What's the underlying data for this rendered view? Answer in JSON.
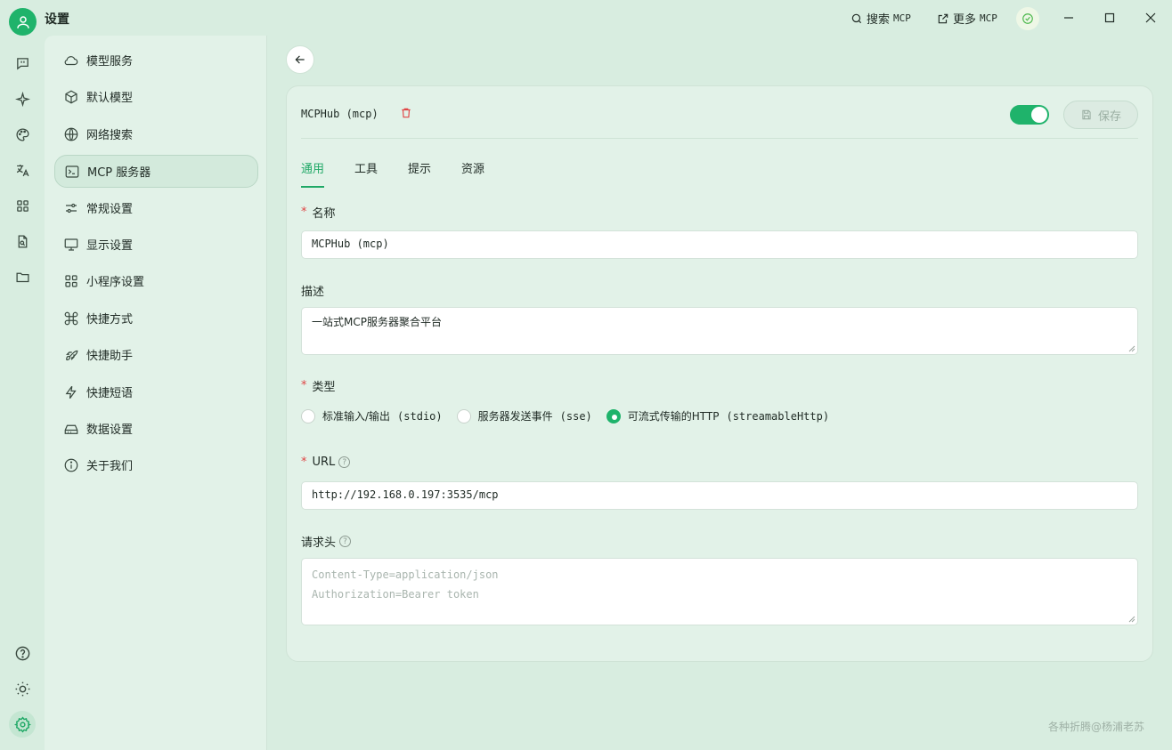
{
  "app": {
    "title": "设置"
  },
  "toolbar": {
    "search_label": "搜索",
    "search_suffix": "MCP",
    "more_label": "更多",
    "more_suffix": "MCP"
  },
  "sidebar": {
    "items": [
      {
        "label": "模型服务",
        "icon": "cloud-icon"
      },
      {
        "label": "默认模型",
        "icon": "cube-icon"
      },
      {
        "label": "网络搜索",
        "icon": "globe-icon"
      },
      {
        "label": "MCP 服务器",
        "icon": "terminal-icon",
        "active": true
      },
      {
        "label": "常规设置",
        "icon": "sliders-icon"
      },
      {
        "label": "显示设置",
        "icon": "monitor-icon"
      },
      {
        "label": "小程序设置",
        "icon": "grid-icon"
      },
      {
        "label": "快捷方式",
        "icon": "command-icon"
      },
      {
        "label": "快捷助手",
        "icon": "rocket-icon"
      },
      {
        "label": "快捷短语",
        "icon": "zap-icon"
      },
      {
        "label": "数据设置",
        "icon": "drive-icon"
      },
      {
        "label": "关于我们",
        "icon": "info-icon"
      }
    ]
  },
  "server": {
    "title": "MCPHub (mcp)",
    "enabled": true,
    "save_label": "保存"
  },
  "tabs": [
    "通用",
    "工具",
    "提示",
    "资源"
  ],
  "form": {
    "name_label": "名称",
    "name_value": "MCPHub (mcp)",
    "desc_label": "描述",
    "desc_value": "一站式MCP服务器聚合平台",
    "type_label": "类型",
    "type_options": [
      {
        "label": "标准输入/输出",
        "suffix": "(stdio)"
      },
      {
        "label": "服务器发送事件",
        "suffix": "(sse)"
      },
      {
        "label": "可流式传输的HTTP",
        "suffix": "(streamableHttp)",
        "selected": true
      }
    ],
    "url_label": "URL",
    "url_value": "http://192.168.0.197:3535/mcp",
    "headers_label": "请求头",
    "headers_placeholder_line1": "Content-Type=application/json",
    "headers_placeholder_line2": "Authorization=Bearer token"
  },
  "watermark": "各种折腾@杨浦老苏",
  "colors": {
    "accent": "#1fb36b",
    "danger": "#e04545",
    "background": "#d8ede0"
  }
}
